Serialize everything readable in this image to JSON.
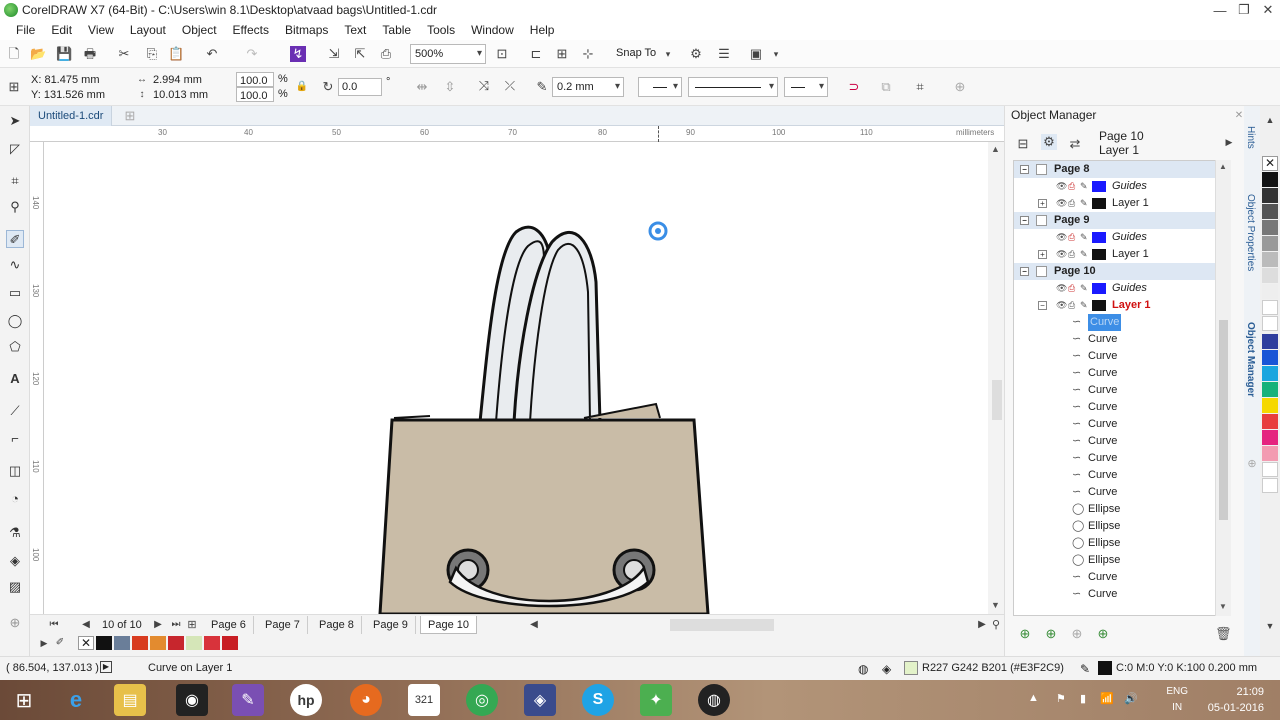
{
  "window": {
    "title": "CorelDRAW X7 (64-Bit) - C:\\Users\\win 8.1\\Desktop\\atvaad bags\\Untitled-1.cdr",
    "minimize": "—",
    "maximize": "❐",
    "close": "✕"
  },
  "menu": [
    "File",
    "Edit",
    "View",
    "Layout",
    "Object",
    "Effects",
    "Bitmaps",
    "Text",
    "Table",
    "Tools",
    "Window",
    "Help"
  ],
  "toolbar": {
    "zoom": "500%",
    "snap_to": "Snap To"
  },
  "property_bar": {
    "x": "X: 81.475 mm",
    "y": "Y: 131.526 mm",
    "width": "2.994 mm",
    "height": "10.013 mm",
    "scale_w": "100.0",
    "scale_h": "100.0",
    "percent": "%",
    "rotation": "0.0",
    "degree": "°",
    "outline_width": "0.2 mm"
  },
  "document_tab": "Untitled-1.cdr",
  "ruler": {
    "units": "millimeters",
    "h_ticks": [
      "30",
      "40",
      "50",
      "60",
      "70",
      "80",
      "90",
      "100",
      "110"
    ],
    "v_ticks": [
      "140",
      "130",
      "120",
      "110",
      "100"
    ]
  },
  "page_nav": {
    "counter": "10 of 10",
    "pages": [
      "Page 6",
      "Page 7",
      "Page 8",
      "Page 9",
      "Page 10"
    ],
    "active": "Page 10"
  },
  "object_manager": {
    "title": "Object Manager",
    "current_page": "Page 10",
    "current_layer": "Layer 1",
    "tree": [
      {
        "type": "page",
        "label": "Page 8"
      },
      {
        "type": "layer",
        "label": "Guides",
        "color": "#1a1aff"
      },
      {
        "type": "layer",
        "label": "Layer 1",
        "color": "#111111"
      },
      {
        "type": "page",
        "label": "Page 9"
      },
      {
        "type": "layer",
        "label": "Guides",
        "color": "#1a1aff"
      },
      {
        "type": "layer",
        "label": "Layer 1",
        "color": "#111111"
      },
      {
        "type": "page",
        "label": "Page 10"
      },
      {
        "type": "layer",
        "label": "Guides",
        "color": "#1a1aff"
      },
      {
        "type": "layer-active",
        "label": "Layer 1",
        "color": "#111111"
      },
      {
        "type": "object",
        "label": "Curve",
        "icon": "curve-icon",
        "selected": true
      },
      {
        "type": "object",
        "label": "Curve",
        "icon": "curve-icon"
      },
      {
        "type": "object",
        "label": "Curve",
        "icon": "curve-icon"
      },
      {
        "type": "object",
        "label": "Curve",
        "icon": "curve-icon"
      },
      {
        "type": "object",
        "label": "Curve",
        "icon": "curve-icon"
      },
      {
        "type": "object",
        "label": "Curve",
        "icon": "curve-icon"
      },
      {
        "type": "object",
        "label": "Curve",
        "icon": "curve-icon"
      },
      {
        "type": "object",
        "label": "Curve",
        "icon": "curve-icon"
      },
      {
        "type": "object",
        "label": "Curve",
        "icon": "curve-icon"
      },
      {
        "type": "object",
        "label": "Curve",
        "icon": "curve-icon"
      },
      {
        "type": "object",
        "label": "Curve",
        "icon": "curve-icon"
      },
      {
        "type": "object",
        "label": "Ellipse",
        "icon": "ellipse-icon"
      },
      {
        "type": "object",
        "label": "Ellipse",
        "icon": "ellipse-icon"
      },
      {
        "type": "object",
        "label": "Ellipse",
        "icon": "ellipse-icon"
      },
      {
        "type": "object",
        "label": "Ellipse",
        "icon": "ellipse-icon"
      },
      {
        "type": "object",
        "label": "Curve",
        "icon": "curve-icon"
      },
      {
        "type": "object",
        "label": "Curve",
        "icon": "curve-icon"
      }
    ]
  },
  "docker_tabs": [
    "Hints",
    "Object Properties",
    "Object Manager"
  ],
  "status": {
    "coords": "( 86.504, 137.013 )",
    "info": "Curve on Layer 1",
    "fill_color": "R227 G242 B201 (#E3F2C9)",
    "outline": "C:0 M:0 Y:0 K:100  0.200 mm"
  },
  "colors": {
    "fill_swatch": "#E3F2C9",
    "bag_body": "#c9bca7",
    "accent": "#2a5d95",
    "guides": "#1a1aff"
  },
  "taskbar": {
    "lang": "ENG",
    "lang2": "IN",
    "time": "21:09",
    "date": "05-01-2016"
  }
}
